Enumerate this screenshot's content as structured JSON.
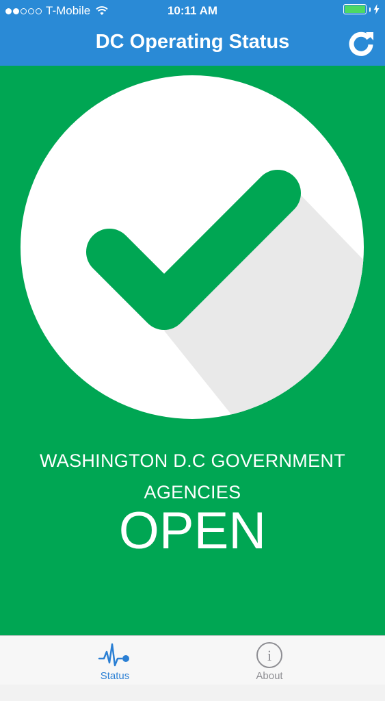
{
  "status_bar": {
    "carrier": "T-Mobile",
    "time": "10:11 AM",
    "signal_strength": 2,
    "signal_total": 5,
    "battery_level": 1.0,
    "icons": [
      "signal-dots-icon",
      "wifi-icon",
      "battery-icon",
      "charging-bolt-icon"
    ]
  },
  "nav": {
    "title": "DC Operating Status",
    "refresh_icon": "refresh-icon"
  },
  "status": {
    "agency_line1": "WASHINGTON D.C GOVERNMENT",
    "agency_line2": "AGENCIES",
    "state": "OPEN",
    "icon": "checkmark-icon"
  },
  "colors": {
    "header_blue": "#2a8ad6",
    "status_green": "#00a653",
    "tab_active": "#2a7fd4",
    "tab_inactive": "#8e8e93"
  },
  "tabs": [
    {
      "label": "Status",
      "icon": "pulse-icon",
      "active": true
    },
    {
      "label": "About",
      "icon": "info-icon",
      "active": false
    }
  ]
}
